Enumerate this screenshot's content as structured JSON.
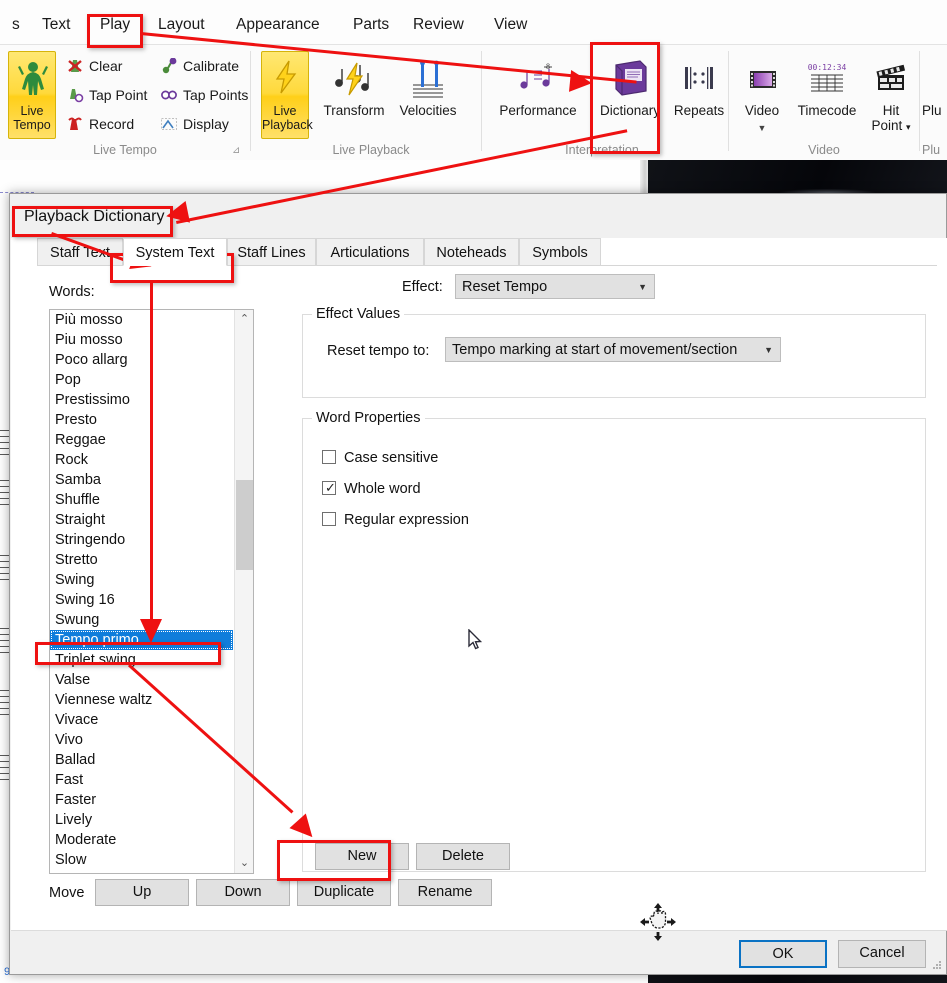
{
  "app": {
    "menu_items": [
      "s",
      "Text",
      "Play",
      "Layout",
      "Appearance",
      "Parts",
      "Review",
      "View"
    ],
    "active_menu": "Play"
  },
  "ribbon": {
    "groups": [
      {
        "title": "Live Tempo",
        "big_button": {
          "label_line1": "Live",
          "label_line2": "Tempo",
          "icon": "conductor-icon"
        },
        "small_items": [
          {
            "label": "Clear",
            "icon": "clear-metronome-icon"
          },
          {
            "label": "Tap Point",
            "icon": "tap-point-icon"
          },
          {
            "label": "Record",
            "icon": "record-icon"
          },
          {
            "label": "Calibrate",
            "icon": "calibrate-icon"
          },
          {
            "label": "Tap Points",
            "icon": "tap-points-icon"
          },
          {
            "label": "Display",
            "icon": "display-icon"
          }
        ],
        "dialog_launcher": "dialog-launcher-icon"
      },
      {
        "title": "Live Playback",
        "big_button": {
          "label_line1": "Live",
          "label_line2": "Playback",
          "icon": "lightning-icon"
        },
        "med_items": [
          {
            "label": "Transform",
            "icon": "transform-notes-icon"
          },
          {
            "label": "Velocities",
            "icon": "velocities-icon"
          }
        ]
      },
      {
        "title": "Interpretation",
        "med_items": [
          {
            "label": "Performance",
            "icon": "performance-icon"
          },
          {
            "label": "Dictionary",
            "icon": "dictionary-book-icon"
          },
          {
            "label": "Repeats",
            "icon": "repeats-barline-icon"
          }
        ]
      },
      {
        "title": "Video",
        "med_items": [
          {
            "label": "Video",
            "icon": "film-strip-icon",
            "has_dropdown": true
          },
          {
            "label": "Timecode",
            "icon": "timecode-icon",
            "timecode_text": "00:12:34"
          },
          {
            "label": "Hit Point",
            "icon": "clapperboard-icon",
            "has_dropdown": true
          }
        ]
      },
      {
        "title": "Plu",
        "med_items": [
          {
            "label": "Plu",
            "icon": "plugin-icon"
          }
        ]
      }
    ]
  },
  "dialog": {
    "title": "Playback Dictionary",
    "tabs": [
      {
        "label": "Staff Text",
        "active": false
      },
      {
        "label": "System Text",
        "active": true
      },
      {
        "label": "Staff Lines",
        "active": false
      },
      {
        "label": "Articulations",
        "active": false
      },
      {
        "label": "Noteheads",
        "active": false
      },
      {
        "label": "Symbols",
        "active": false
      }
    ],
    "words_label": "Words:",
    "words": [
      {
        "label": "Più mosso",
        "selected": false
      },
      {
        "label": "Piu mosso",
        "selected": false
      },
      {
        "label": "Poco allarg",
        "selected": false
      },
      {
        "label": "Pop",
        "selected": false
      },
      {
        "label": "Prestissimo",
        "selected": false
      },
      {
        "label": "Presto",
        "selected": false
      },
      {
        "label": "Reggae",
        "selected": false
      },
      {
        "label": "Rock",
        "selected": false
      },
      {
        "label": "Samba",
        "selected": false
      },
      {
        "label": "Shuffle",
        "selected": false
      },
      {
        "label": "Straight",
        "selected": false
      },
      {
        "label": "Stringendo",
        "selected": false
      },
      {
        "label": "Stretto",
        "selected": false
      },
      {
        "label": "Swing",
        "selected": false
      },
      {
        "label": "Swing 16",
        "selected": false
      },
      {
        "label": "Swung",
        "selected": false
      },
      {
        "label": "Tempo primo",
        "selected": true
      },
      {
        "label": "Triplet swing",
        "selected": false
      },
      {
        "label": "Valse",
        "selected": false
      },
      {
        "label": "Viennese waltz",
        "selected": false
      },
      {
        "label": "Vivace",
        "selected": false
      },
      {
        "label": "Vivo",
        "selected": false
      },
      {
        "label": "Ballad",
        "selected": false
      },
      {
        "label": "Fast",
        "selected": false
      },
      {
        "label": "Faster",
        "selected": false
      },
      {
        "label": "Lively",
        "selected": false
      },
      {
        "label": "Moderate",
        "selected": false
      },
      {
        "label": "Slow",
        "selected": false
      }
    ],
    "effect_label": "Effect:",
    "effect_value": "Reset Tempo",
    "effect_values_group": "Effect Values",
    "reset_tempo_label": "Reset tempo to:",
    "reset_tempo_value": "Tempo marking at start of movement/section",
    "word_properties_group": "Word Properties",
    "checkboxes": [
      {
        "label": "Case sensitive",
        "checked": false
      },
      {
        "label": "Whole word",
        "checked": true
      },
      {
        "label": "Regular expression",
        "checked": false
      }
    ],
    "new_button": "New",
    "delete_button": "Delete",
    "move_label": "Move",
    "up_button": "Up",
    "down_button": "Down",
    "duplicate_button": "Duplicate",
    "rename_button": "Rename",
    "ok_button": "OK",
    "cancel_button": "Cancel"
  },
  "annotations": {
    "highlight_color": "#ee1111",
    "boxes": [
      "play-menu-tab",
      "dictionary-ribbon-button",
      "playback-dictionary-title",
      "system-text-tab",
      "tempo-primo-list-item",
      "new-button"
    ]
  }
}
